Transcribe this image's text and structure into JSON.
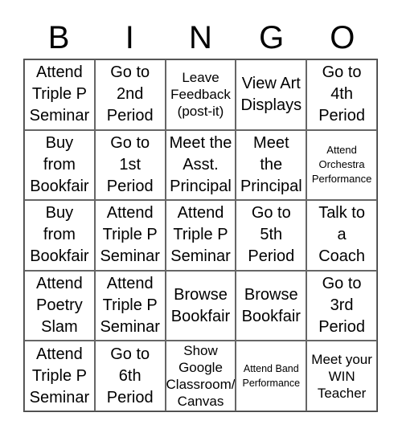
{
  "title_letters": [
    "B",
    "I",
    "N",
    "G",
    "O"
  ],
  "cells": [
    [
      {
        "text": "Attend Triple P Seminar",
        "size": "l"
      },
      {
        "text": "Go to 2nd Period",
        "size": "l"
      },
      {
        "text": "Leave Feedback (post-it)",
        "size": "m"
      },
      {
        "text": "View Art Displays",
        "size": "l"
      },
      {
        "text": "Go to 4th Period",
        "size": "l"
      }
    ],
    [
      {
        "text": "Buy from Bookfair",
        "size": "l"
      },
      {
        "text": "Go to 1st Period",
        "size": "l"
      },
      {
        "text": "Meet the Asst. Principal",
        "size": "l"
      },
      {
        "text": "Meet the Principal",
        "size": "l"
      },
      {
        "text": "Attend Orchestra Performance",
        "size": "s"
      }
    ],
    [
      {
        "text": "Buy from Bookfair",
        "size": "l"
      },
      {
        "text": "Attend Triple P Seminar",
        "size": "l"
      },
      {
        "text": "Attend Triple P Seminar",
        "size": "l"
      },
      {
        "text": "Go to 5th Period",
        "size": "l"
      },
      {
        "text": "Talk to a Coach",
        "size": "l"
      }
    ],
    [
      {
        "text": "Attend Poetry Slam",
        "size": "l"
      },
      {
        "text": "Attend Triple P Seminar",
        "size": "l"
      },
      {
        "text": "Browse Bookfair",
        "size": "l"
      },
      {
        "text": "Browse Bookfair",
        "size": "l"
      },
      {
        "text": "Go to 3rd Period",
        "size": "l"
      }
    ],
    [
      {
        "text": "Attend Triple P Seminar",
        "size": "l"
      },
      {
        "text": "Go to 6th Period",
        "size": "l"
      },
      {
        "text": "Show Google Classroom/ Canvas",
        "size": "m"
      },
      {
        "text": "Attend Band Performance",
        "size": "xs"
      },
      {
        "text": "Meet your WIN Teacher",
        "size": "m"
      }
    ]
  ],
  "cell_lines": [
    [
      [
        "Attend",
        "Triple P",
        "Seminar"
      ],
      [
        "Go to",
        "2nd",
        "Period"
      ],
      [
        "Leave",
        "Feedback",
        "(post-it)"
      ],
      [
        "View Art",
        "Displays"
      ],
      [
        "Go to",
        "4th",
        "Period"
      ]
    ],
    [
      [
        "Buy",
        "from",
        "Bookfair"
      ],
      [
        "Go to",
        "1st",
        "Period"
      ],
      [
        "Meet the",
        "Asst.",
        "Principal"
      ],
      [
        "Meet",
        "the",
        "Principal"
      ],
      [
        "Attend",
        "Orchestra",
        "Performance"
      ]
    ],
    [
      [
        "Buy",
        "from",
        "Bookfair"
      ],
      [
        "Attend",
        "Triple P",
        "Seminar"
      ],
      [
        "Attend",
        "Triple P",
        "Seminar"
      ],
      [
        "Go to",
        "5th",
        "Period"
      ],
      [
        "Talk to",
        "a",
        "Coach"
      ]
    ],
    [
      [
        "Attend",
        "Poetry",
        "Slam"
      ],
      [
        "Attend",
        "Triple P",
        "Seminar"
      ],
      [
        "Browse",
        "Bookfair"
      ],
      [
        "Browse",
        "Bookfair"
      ],
      [
        "Go to",
        "3rd",
        "Period"
      ]
    ],
    [
      [
        "Attend",
        "Triple P",
        "Seminar"
      ],
      [
        "Go to",
        "6th",
        "Period"
      ],
      [
        "Show",
        "Google",
        "Classroom/",
        "Canvas"
      ],
      [
        "Attend Band",
        "Performance"
      ],
      [
        "Meet your",
        "WIN",
        "Teacher"
      ]
    ]
  ],
  "colors": {
    "border": "#444444",
    "text": "#000000",
    "background": "#ffffff"
  }
}
